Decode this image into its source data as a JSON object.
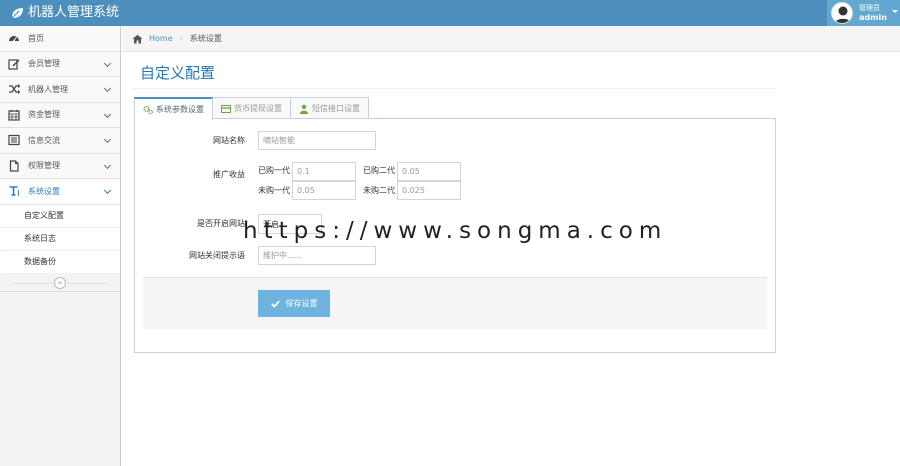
{
  "app": {
    "title": "机器人管理系统"
  },
  "user": {
    "welcome": "管理员",
    "name": "admin"
  },
  "sidebar": {
    "items": [
      {
        "label": "首页",
        "icon": "dashboard-icon",
        "has_arrow": false
      },
      {
        "label": "会员管理",
        "icon": "edit-icon",
        "has_arrow": true
      },
      {
        "label": "机器人管理",
        "icon": "shuffle-icon",
        "has_arrow": true
      },
      {
        "label": "资金管理",
        "icon": "calendar-icon",
        "has_arrow": true
      },
      {
        "label": "信息交流",
        "icon": "list-icon",
        "has_arrow": true
      },
      {
        "label": "权限管理",
        "icon": "file-icon",
        "has_arrow": true
      },
      {
        "label": "系统设置",
        "icon": "text-height-icon",
        "has_arrow": true,
        "active": true
      }
    ],
    "submenu": [
      {
        "label": "自定义配置"
      },
      {
        "label": "系统日志"
      },
      {
        "label": "数据备份"
      }
    ],
    "collapse_glyph": "«"
  },
  "breadcrumb": {
    "home": "Home",
    "separator": "›",
    "current": "系统设置"
  },
  "page": {
    "title": "自定义配置"
  },
  "tabs": [
    {
      "label": "系统参数设置",
      "icon": "cogs-icon",
      "active": true
    },
    {
      "label": "货币提现设置",
      "icon": "credit-card-icon",
      "active": false
    },
    {
      "label": "短信接口设置",
      "icon": "user-icon",
      "active": false
    }
  ],
  "form": {
    "site_name": {
      "label": "网站名称",
      "value": "嘀站智能"
    },
    "promo": {
      "label": "推广收益",
      "bought_first_label": "已购一代",
      "bought_first_value": "0.1",
      "bought_second_label": "已购二代",
      "bought_second_value": "0.05",
      "unbought_first_label": "未购一代",
      "unbought_first_value": "0.05",
      "unbought_second_label": "未购二代",
      "unbought_second_value": "0.025"
    },
    "site_open": {
      "label": "是否开启网站",
      "value": "开启"
    },
    "close_notice": {
      "label": "网站关闭提示语",
      "value": "维护中......"
    },
    "save_label": "保存设置"
  },
  "watermark": "https://www.songma.com",
  "colors": {
    "navbar": "#4c8fbd",
    "accent": "#2679b5",
    "button": "#6fb3e0"
  }
}
